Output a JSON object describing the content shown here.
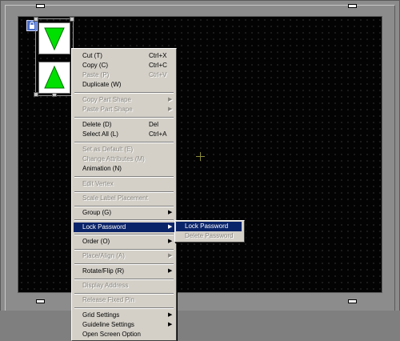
{
  "colors": {
    "canvas": "#030303",
    "menu_bg": "#d4d0c8",
    "highlight": "#0a246a",
    "disabled_text": "#8a8780",
    "part_green": "#00e000"
  },
  "context_menu": {
    "cut": {
      "label": "Cut (T)",
      "shortcut": "Ctrl+X"
    },
    "copy": {
      "label": "Copy (C)",
      "shortcut": "Ctrl+C"
    },
    "paste": {
      "label": "Paste (P)",
      "shortcut": "Ctrl+V"
    },
    "duplicate": {
      "label": "Duplicate (W)"
    },
    "copy_part_shape": {
      "label": "Copy Part Shape"
    },
    "paste_part_shape": {
      "label": "Paste Part Shape"
    },
    "delete": {
      "label": "Delete (D)",
      "shortcut": "Del"
    },
    "select_all": {
      "label": "Select All (L)",
      "shortcut": "Ctrl+A"
    },
    "set_as_default": {
      "label": "Set as Default (E)"
    },
    "change_attributes": {
      "label": "Change Attributes (M)"
    },
    "animation": {
      "label": "Animation (N)"
    },
    "edit_vertex": {
      "label": "Edit Vertex"
    },
    "scale_label_placement": {
      "label": "Scale Label Placement"
    },
    "group": {
      "label": "Group (G)"
    },
    "lock_password": {
      "label": "Lock Password"
    },
    "order": {
      "label": "Order (O)"
    },
    "place_align": {
      "label": "Place/Align (A)"
    },
    "rotate_flip": {
      "label": "Rotate/Flip (R)"
    },
    "display_address": {
      "label": "Display Address"
    },
    "release_fixed_pin": {
      "label": "Release Fixed Pin"
    },
    "grid_settings": {
      "label": "Grid Settings"
    },
    "guideline_settings": {
      "label": "Guideline Settings"
    },
    "open_screen_option": {
      "label": "Open Screen Option"
    }
  },
  "submenu": {
    "lock_password": {
      "label": "Lock Password"
    },
    "delete_password": {
      "label": "Delete Password"
    }
  },
  "icons": {
    "lock": "lock-icon",
    "submenu_arrow": "chevron-right-icon"
  }
}
